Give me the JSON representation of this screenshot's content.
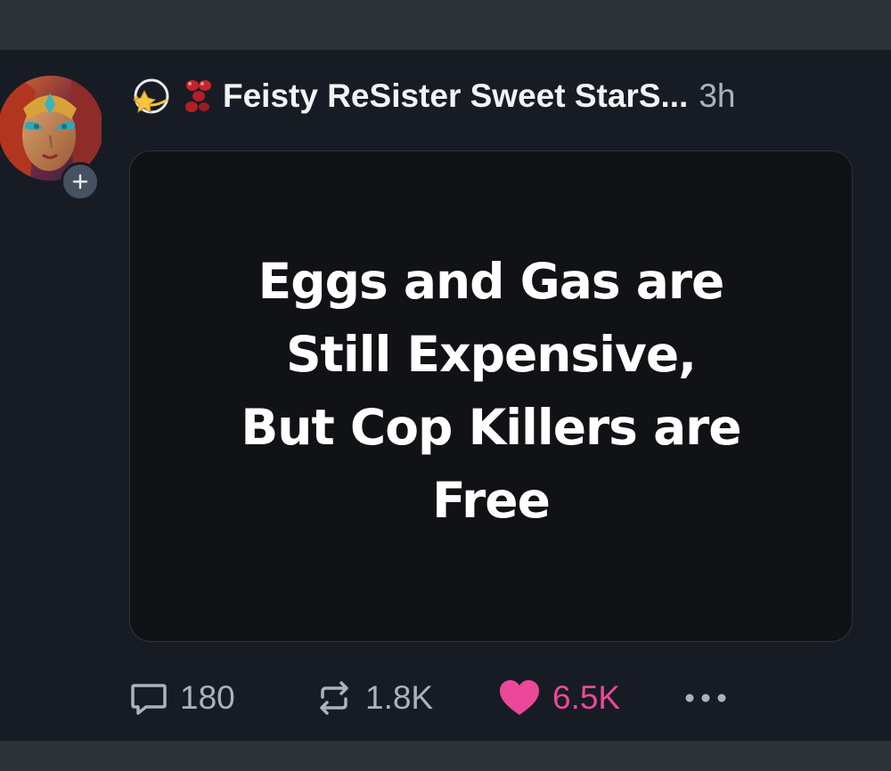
{
  "post": {
    "author_name": "Feisty ReSister Sweet StarS...",
    "timestamp": "3h",
    "emojis": [
      "dizzy-icon",
      "red-beads-icon"
    ],
    "image_text_lines": [
      "Eggs and Gas are",
      "Still Expensive,",
      "But Cop Killers are",
      "Free"
    ],
    "actions": {
      "replies": "180",
      "reposts": "1.8K",
      "likes": "6.5K",
      "liked": true
    }
  },
  "colors": {
    "background": "#171c24",
    "band": "#2d3138",
    "card": "#111215",
    "text_primary": "#f2f3f5",
    "text_muted": "#aab2bd",
    "like_accent": "#ec4899",
    "badge": "#475260"
  },
  "icons": {
    "reply": "speech-bubble-icon",
    "repost": "repost-arrows-icon",
    "like": "heart-icon",
    "more": "ellipsis-icon",
    "follow": "plus-icon"
  }
}
